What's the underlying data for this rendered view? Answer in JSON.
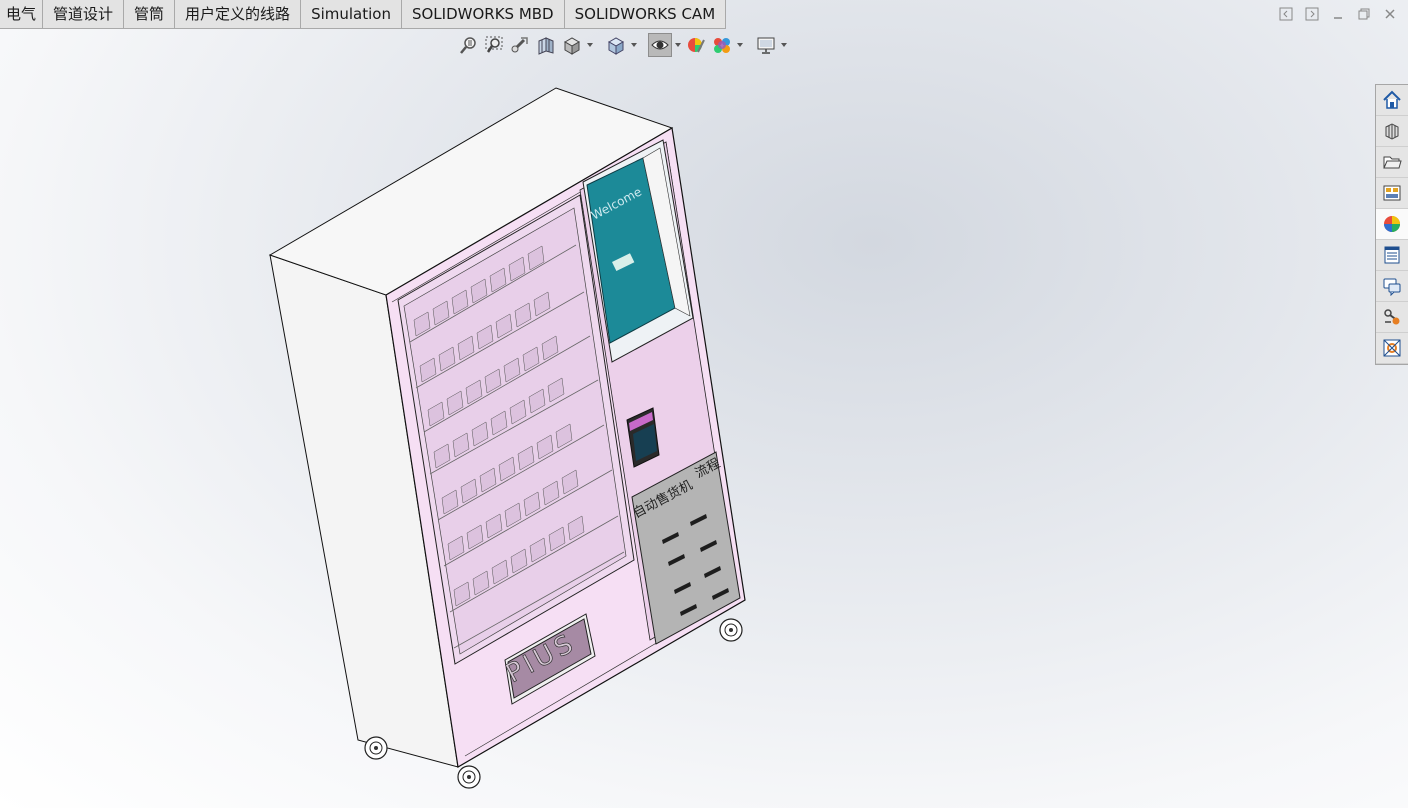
{
  "command_tabs": [
    {
      "label": "电气"
    },
    {
      "label": "管道设计"
    },
    {
      "label": "管筒"
    },
    {
      "label": "用户定义的线路"
    },
    {
      "label": "Simulation"
    },
    {
      "label": "SOLIDWORKS MBD"
    },
    {
      "label": "SOLIDWORKS CAM"
    }
  ],
  "heads_up_toolbar": [
    "zoom-to-fit-icon",
    "zoom-to-area-icon",
    "previous-view-icon",
    "section-view-icon",
    "view-orientation-icon",
    "display-style-icon",
    "hide-show-items-icon",
    "edit-appearance-icon",
    "apply-scene-icon",
    "view-settings-icon"
  ],
  "task_pane": [
    "solidworks-resources-icon",
    "design-library-icon",
    "file-explorer-icon",
    "view-palette-icon",
    "appearances-scenes-icon",
    "custom-properties-icon",
    "forum-icon",
    "solidworks-3dexperience-icon",
    "toolbox-icon"
  ],
  "model": {
    "name": "vending-machine",
    "plate_text": "PIUS",
    "screen_text": "Welcome",
    "flow_title": "自动售货机",
    "flow_suffix": "流程"
  },
  "colors": {
    "cabinet_front": "#f5dcf3",
    "cabinet_side": "#f4f4f4",
    "panel": "#e8c9e6",
    "screen": "#1c8a98",
    "flow_panel": "#b4b4b4"
  }
}
